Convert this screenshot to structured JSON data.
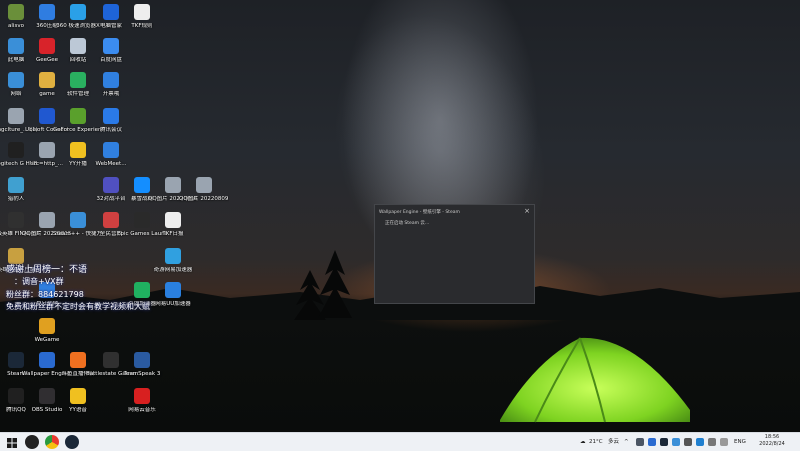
{
  "desktop_icons": [
    {
      "label": "alisvo",
      "icon": "app-icon",
      "color": "#6a8f3a"
    },
    {
      "label": "360压缩",
      "icon": "archive-icon",
      "color": "#2f7de1"
    },
    {
      "label": "360 极速浏览器X",
      "icon": "browser-icon",
      "color": "#2aa0e8"
    },
    {
      "label": "电脑管家",
      "icon": "shield-icon",
      "color": "#1e64d8"
    },
    {
      "label": "TKF规则",
      "icon": "file-icon",
      "color": "#eeeeee"
    },
    {
      "label": "此电脑",
      "icon": "computer-icon",
      "color": "#3a8fd8"
    },
    {
      "label": "GeeGee",
      "icon": "gg-icon",
      "color": "#d8232a"
    },
    {
      "label": "回收站",
      "icon": "recycle-bin-icon",
      "color": "#bcc8d6"
    },
    {
      "label": "百度网盘",
      "icon": "cloud-drive-icon",
      "color": "#3b8cf0"
    },
    {
      "label": "网络",
      "icon": "network-icon",
      "color": "#3a8fd8"
    },
    {
      "label": "game",
      "icon": "folder-icon",
      "color": "#e0b040"
    },
    {
      "label": "软件管理",
      "icon": "software-manager-icon",
      "color": "#2ab060"
    },
    {
      "label": "开票哦",
      "icon": "invoice-icon",
      "color": "#3080e0"
    },
    {
      "label": "imgclture_... (1)",
      "icon": "image-file-icon",
      "color": "#9aa4b0"
    },
    {
      "label": "Ubisoft Connect",
      "icon": "ubisoft-icon",
      "color": "#2058d0"
    },
    {
      "label": "GeForce Experience",
      "icon": "geforce-icon",
      "color": "#5aa02c"
    },
    {
      "label": "腾讯会议",
      "icon": "meeting-icon",
      "color": "#2a7ae8"
    },
    {
      "label": "Logitech G HUB",
      "icon": "logitech-icon",
      "color": "#202020"
    },
    {
      "label": "src=http_...",
      "icon": "image-file-icon",
      "color": "#9aa4b0"
    },
    {
      "label": "YY开播",
      "icon": "yy-icon",
      "color": "#f0c020"
    },
    {
      "label": "WebMeet...",
      "icon": "webmeet-icon",
      "color": "#3080e0"
    },
    {
      "label": "32对战平台",
      "icon": "battle-platform-icon",
      "color": "#5050c0"
    },
    {
      "label": "暴雪战网",
      "icon": "battlenet-icon",
      "color": "#148eff"
    },
    {
      "label": "QQ图片 20220808...",
      "icon": "image-file-icon",
      "color": "#9aa4b0"
    },
    {
      "label": "QQ图片 20220809...",
      "icon": "image-file-icon",
      "color": "#9aa4b0"
    },
    {
      "label": "猎豹人",
      "icon": "app-icon",
      "color": "#40a0d0"
    },
    {
      "label": "超级英雄 FINAL BETA",
      "icon": "game-icon",
      "color": "#303030"
    },
    {
      "label": "QQ图片 20220815...",
      "icon": "image-file-icon",
      "color": "#9aa4b0"
    },
    {
      "label": "Steam++ - 快捷方式",
      "icon": "steam-plus-icon",
      "color": "#3a8fd8"
    },
    {
      "label": "全民营救",
      "icon": "game-icon",
      "color": "#d04040"
    },
    {
      "label": "Epic Games Launcher",
      "icon": "epic-icon",
      "color": "#2a2a2a"
    },
    {
      "label": "TKF日报",
      "icon": "file-icon",
      "color": "#eeeeee"
    },
    {
      "label": "奇游网易加速器",
      "icon": "accelerator-icon",
      "color": "#30a0e0"
    },
    {
      "label": "英雄联盟客户端",
      "icon": "lol-icon",
      "color": "#c8a040"
    },
    {
      "label": "夏日营地",
      "icon": "app-icon",
      "color": "#3080e0"
    },
    {
      "label": "百团加速器",
      "icon": "accelerator-icon",
      "color": "#20b060"
    },
    {
      "label": "网易UU加速器",
      "icon": "uu-icon",
      "color": "#2a80e0"
    },
    {
      "label": "WeGame",
      "icon": "wegame-icon",
      "color": "#e0a020"
    },
    {
      "label": "Steam",
      "icon": "steam-icon",
      "color": "#1b2838"
    },
    {
      "label": "Wallpaper Engine: ...",
      "icon": "wallpaper-engine-icon",
      "color": "#2a6ad0"
    },
    {
      "label": "斗鱼直播伴侣",
      "icon": "douyu-icon",
      "color": "#f07020"
    },
    {
      "label": "Battlestate Games L...",
      "icon": "battlestate-icon",
      "color": "#303030"
    },
    {
      "label": "TeamSpeak 3",
      "icon": "teamspeak-icon",
      "color": "#2a5aa0"
    },
    {
      "label": "腾讯QQ",
      "icon": "qq-icon",
      "color": "#202020"
    },
    {
      "label": "OBS Studio",
      "icon": "obs-icon",
      "color": "#302e31"
    },
    {
      "label": "YY语音",
      "icon": "yy-icon",
      "color": "#f0c020"
    },
    {
      "label": "网易云音乐",
      "icon": "netease-music-icon",
      "color": "#d82020"
    }
  ],
  "overlay": {
    "line1": "感谢上周榜一：不语",
    "line2": "：调音+VX群",
    "line3": "粉丝群：884621798",
    "line4": "免费和粉丝群不定时会有教学视频和大赋"
  },
  "dialog": {
    "title": "Wallpaper Engine - 壁纸引擎 - Steam",
    "close": "×",
    "message": "正在启动 Steam 云..."
  },
  "taskbar": {
    "weather_temp": "21°C",
    "weather_desc": "多云",
    "language": "ENG",
    "time": "18:56",
    "date": "2022/8/24"
  }
}
